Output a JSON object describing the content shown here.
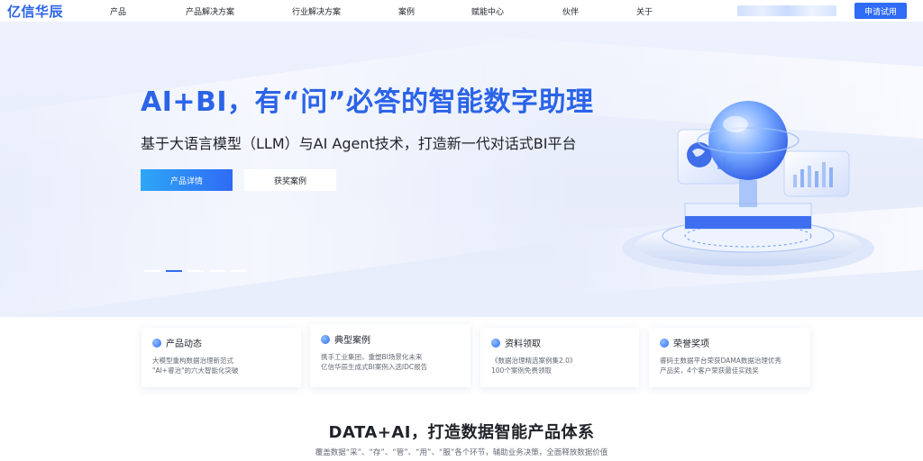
{
  "nav": {
    "logo": "亿信华辰",
    "items": [
      {
        "label": "产品"
      },
      {
        "label": "产品解决方案"
      },
      {
        "label": "行业解决方案"
      },
      {
        "label": "案例"
      },
      {
        "label": "赋能中心"
      },
      {
        "label": "伙伴"
      },
      {
        "label": "关于"
      }
    ],
    "cta": "申请试用"
  },
  "hero": {
    "title": "AI+BI，有“问”必答的智能数字助理",
    "subtitle": "基于大语言模型（LLM）与AI Agent技术，打造新一代对话式BI平台",
    "primary_button": "产品详情",
    "secondary_button": "获奖案例",
    "carousel_active_index": 1,
    "carousel_count": 5
  },
  "cards": [
    {
      "title": "产品动态",
      "icon": "product-news-icon",
      "lines": [
        "大模型重构数据治理新范式",
        "\"AI+睿治\"的六大智能化突破"
      ]
    },
    {
      "title": "典型案例",
      "icon": "case-icon",
      "lines": [
        "携手工业集团，重塑BI场景化未来",
        "亿信华辰生成式BI案例入选IDC报告"
      ]
    },
    {
      "title": "资料领取",
      "icon": "materials-icon",
      "lines": [
        "《数据治理精选案例集2.0》",
        "100个案例免费领取"
      ]
    },
    {
      "title": "荣誉奖项",
      "icon": "award-icon",
      "lines": [
        "睿码主数据平台荣获DAMA数据治理优秀",
        "产品奖，4个客户荣获最佳实践奖"
      ]
    }
  ],
  "section": {
    "title": "DATA+AI，打造数据智能产品体系",
    "subtitle": "覆盖数据“采”、“存”、“管”、“用”、“服”各个环节，辅助业务决策，全面释放数据价值"
  },
  "colors": {
    "brand": "#2b64e8",
    "cta": "#2f6bf5"
  }
}
